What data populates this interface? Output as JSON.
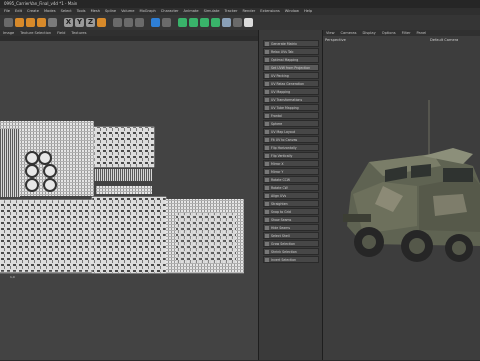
{
  "window": {
    "title": "0995_CarrierVan_Final_v4d *1 - Main"
  },
  "menu": {
    "items": [
      "File",
      "Edit",
      "Create",
      "Modes",
      "Select",
      "Tools",
      "Mesh",
      "Spline",
      "Volume",
      "MoGraph",
      "Character",
      "Animate",
      "Simulate",
      "Tracker",
      "Render",
      "Extensions",
      "Window",
      "Help"
    ]
  },
  "toolbar": {
    "buttons": [
      {
        "name": "undo-icon",
        "color": "#6a6a6a"
      },
      {
        "name": "move-icon",
        "color": "#d88a2a"
      },
      {
        "name": "scale-icon",
        "color": "#d88a2a"
      },
      {
        "name": "rotate-icon",
        "color": "#d88a2a"
      },
      {
        "name": "live-select-icon",
        "color": "#7a7a7a"
      },
      {
        "name": "x-axis-icon",
        "color": "#9a9a9a"
      },
      {
        "name": "y-axis-icon",
        "color": "#9a9a9a"
      },
      {
        "name": "z-axis-icon",
        "color": "#9a9a9a"
      },
      {
        "name": "coordinate-icon",
        "color": "#d88a2a"
      },
      {
        "name": "render-view-icon",
        "color": "#6a6a6a"
      },
      {
        "name": "render-picture-viewer-icon",
        "color": "#6a6a6a"
      },
      {
        "name": "render-settings-icon",
        "color": "#6a6a6a"
      },
      {
        "name": "cube-icon",
        "color": "#2e7fd6"
      },
      {
        "name": "pen-icon",
        "color": "#6a6a6a"
      },
      {
        "name": "subdivision-icon",
        "color": "#39b36a"
      },
      {
        "name": "cloner-icon",
        "color": "#39b36a"
      },
      {
        "name": "deformer-icon",
        "color": "#39b36a"
      },
      {
        "name": "field-icon",
        "color": "#39b36a"
      },
      {
        "name": "floor-icon",
        "color": "#8aa0b8"
      },
      {
        "name": "camera-icon",
        "color": "#6a6a6a"
      },
      {
        "name": "light-icon",
        "color": "#dcdcdc"
      }
    ],
    "xyz": [
      "X",
      "Y",
      "Z"
    ]
  },
  "uv_editor": {
    "menu": [
      "Image",
      "Texture Selection",
      "Field",
      "Textures"
    ],
    "corner_label": "1,0"
  },
  "commands": {
    "items": [
      "Generate Matrix",
      "Relax UVs Tab",
      "Optimal Mapping",
      "Set UVW from Projection",
      "UV Packing",
      "UV Relax Generation",
      "UV Mapping",
      "UV Transformations",
      "UV Tube Mapping",
      "Frontal",
      "Sphere",
      "UV Map Layout",
      "Fit UV to Canvas",
      "Flip Horizontally",
      "Flip Vertically",
      "Mirror X",
      "Mirror Y",
      "Rotate CCW",
      "Rotate CW",
      "Align UVs",
      "Straighten",
      "Snap to Grid",
      "Show Seams",
      "Hide Seams",
      "Select Shell",
      "Grow Selection",
      "Shrink Selection",
      "Invert Selection"
    ],
    "selected_index": 3
  },
  "viewport": {
    "menu": [
      "View",
      "Cameras",
      "Display",
      "Options",
      "Filter",
      "Panel"
    ],
    "label_left": "Perspective",
    "label_camera": "Default Camera"
  }
}
